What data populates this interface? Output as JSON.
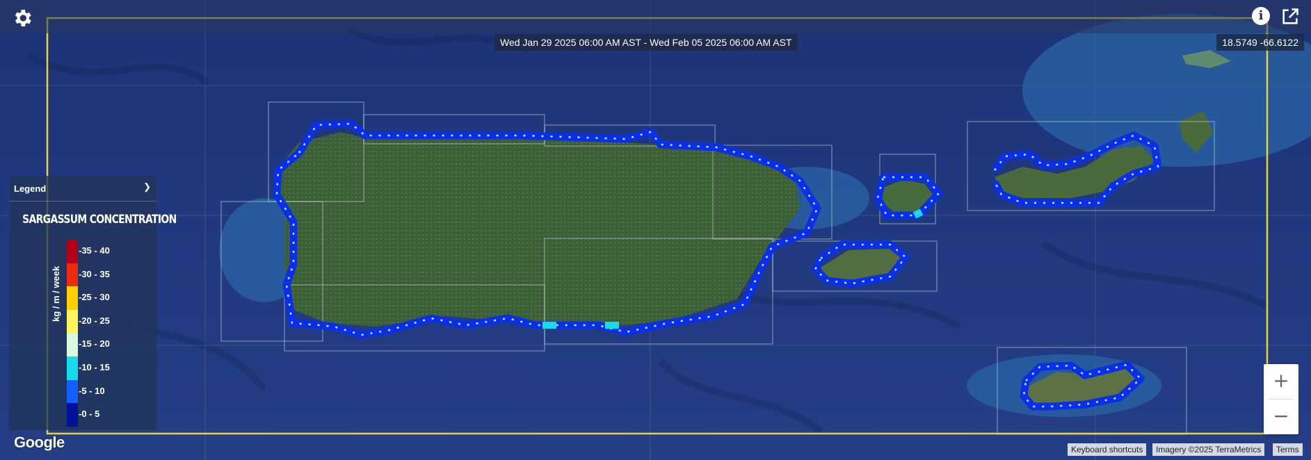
{
  "header": {
    "date_range": "Wed Jan 29 2025 06:00 AM AST - Wed Feb 05 2025 06:00 AM AST",
    "coordinates": "18.5749 -66.6122"
  },
  "legend": {
    "title": "Legend",
    "layer_name": "SARGASSUM CONCENTRATION",
    "unit_label": "kg / m / week",
    "ranges": [
      {
        "label": "-35 - 40",
        "color": "#b5001a"
      },
      {
        "label": "-30 - 35",
        "color": "#ef2b0f"
      },
      {
        "label": "-25 - 30",
        "color": "#ffcf00"
      },
      {
        "label": "-20 - 25",
        "color": "#fff45c"
      },
      {
        "label": "-15 - 20",
        "color": "#d9f7df"
      },
      {
        "label": "-10 - 15",
        "color": "#19d9ec"
      },
      {
        "label": "-5 - 10",
        "color": "#1460ff"
      },
      {
        "label": "-0 - 5",
        "color": "#00119a"
      }
    ]
  },
  "map": {
    "attribution_google": "Google",
    "keyboard_shortcuts": "Keyboard shortcuts",
    "imagery": "Imagery ©2025 TerraMetrics",
    "terms": "Terms",
    "zoom_in": "+",
    "zoom_out": "−",
    "info_symbol": "i"
  },
  "colors": {
    "ocean": "#1c2f6b",
    "land": "#3d5f38",
    "sargassum_low": "#1a4dff",
    "boundary": "#e8d43a"
  }
}
